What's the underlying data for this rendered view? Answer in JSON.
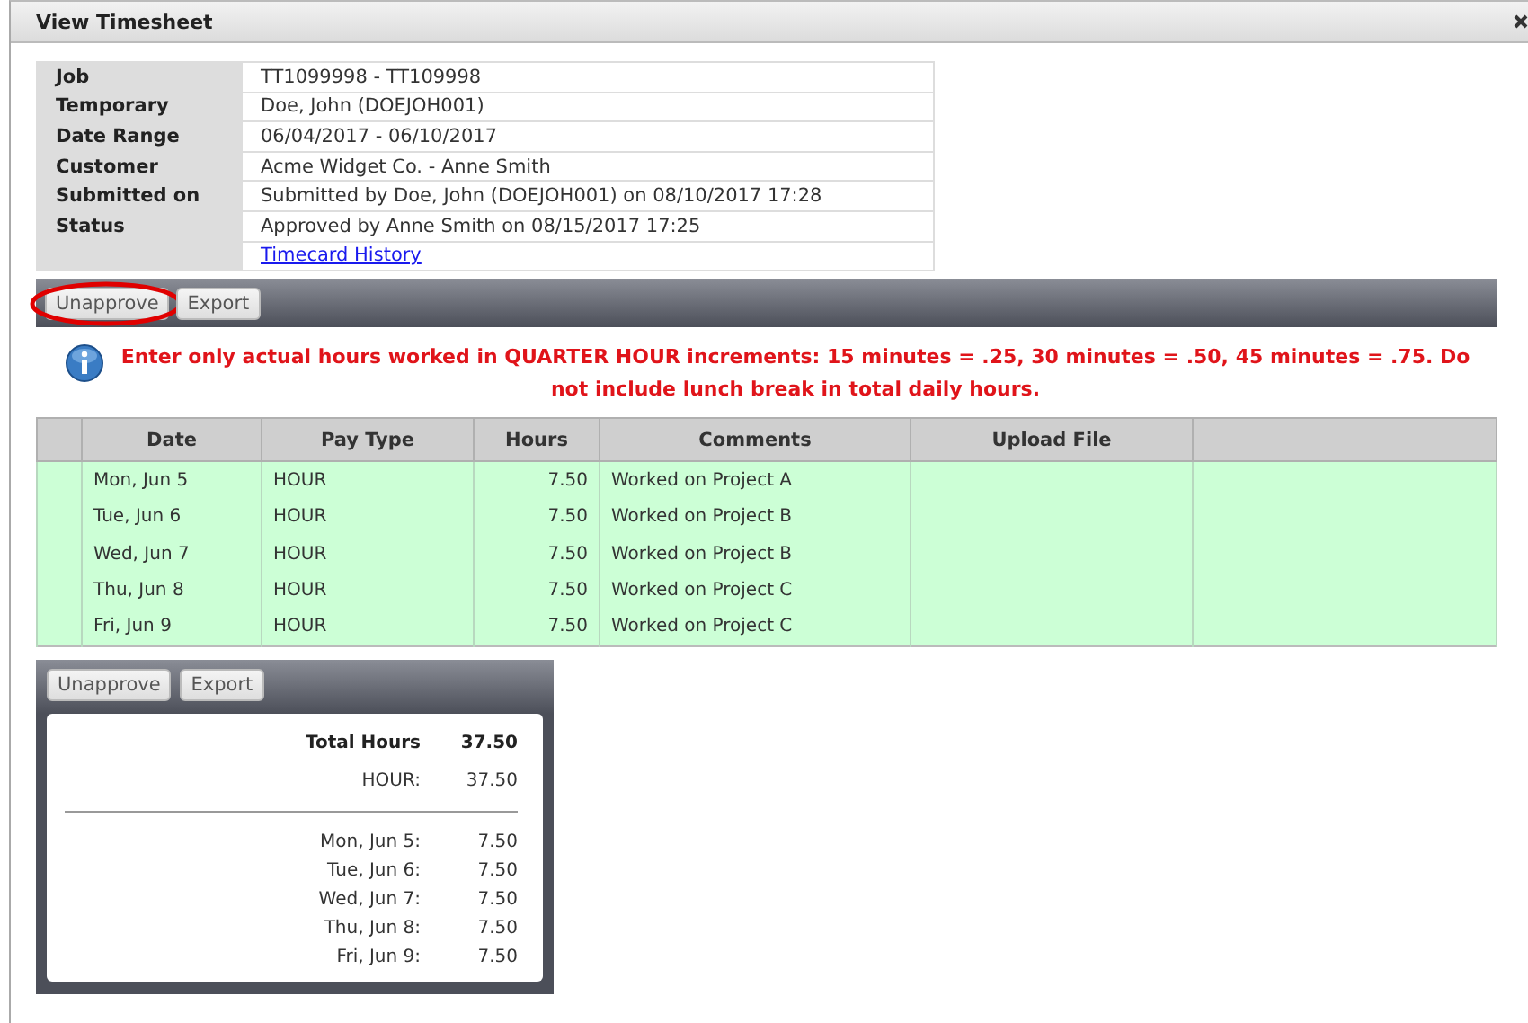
{
  "window": {
    "title": "View Timesheet"
  },
  "details": [
    {
      "label": "Job",
      "value": "TT1099998 - TT109998"
    },
    {
      "label": "Temporary",
      "value": "Doe, John (DOEJOH001)"
    },
    {
      "label": "Date Range",
      "value": "06/04/2017 - 06/10/2017"
    },
    {
      "label": "Customer",
      "value": "Acme Widget Co. - Anne Smith"
    },
    {
      "label": "Submitted on",
      "value": "Submitted by Doe, John (DOEJOH001) on 08/10/2017 17:28"
    },
    {
      "label": "Status",
      "value": "Approved by Anne Smith on 08/15/2017 17:25"
    }
  ],
  "history_link": "Timecard History",
  "toolbar": [
    {
      "label": "Unapprove",
      "highlighted": true
    },
    {
      "label": "Export",
      "highlighted": false
    }
  ],
  "notice": "Enter only actual hours worked in QUARTER HOUR increments: 15 minutes = .25, 30 minutes = .50, 45 minutes = .75. Do not include lunch break in total daily hours.",
  "table": {
    "columns": [
      "Date",
      "Pay Type",
      "Hours",
      "Comments",
      "Upload File"
    ],
    "rows": [
      {
        "date": "Mon, Jun 5",
        "pay_type": "HOUR",
        "hours": "7.50",
        "comments": "Worked on Project A"
      },
      {
        "date": "Tue, Jun 6",
        "pay_type": "HOUR",
        "hours": "7.50",
        "comments": "Worked on Project B"
      },
      {
        "date": "Wed, Jun 7",
        "pay_type": "HOUR",
        "hours": "7.50",
        "comments": "Worked on Project B"
      },
      {
        "date": "Thu, Jun 8",
        "pay_type": "HOUR",
        "hours": "7.50",
        "comments": "Worked on Project C"
      },
      {
        "date": "Fri, Jun 9",
        "pay_type": "HOUR",
        "hours": "7.50",
        "comments": "Worked on Project C"
      }
    ]
  },
  "summary": {
    "buttons": [
      {
        "label": "Unapprove"
      },
      {
        "label": "Export"
      }
    ],
    "total": {
      "label": "Total Hours",
      "value": "37.50"
    },
    "by_type": [
      {
        "label": "HOUR:",
        "value": "37.50"
      }
    ],
    "by_day": [
      {
        "label": "Mon, Jun 5:",
        "value": "7.50"
      },
      {
        "label": "Tue, Jun 6:",
        "value": "7.50"
      },
      {
        "label": "Wed, Jun 7:",
        "value": "7.50"
      },
      {
        "label": "Thu, Jun 8:",
        "value": "7.50"
      },
      {
        "label": "Fri, Jun 9:",
        "value": "7.50"
      }
    ]
  }
}
